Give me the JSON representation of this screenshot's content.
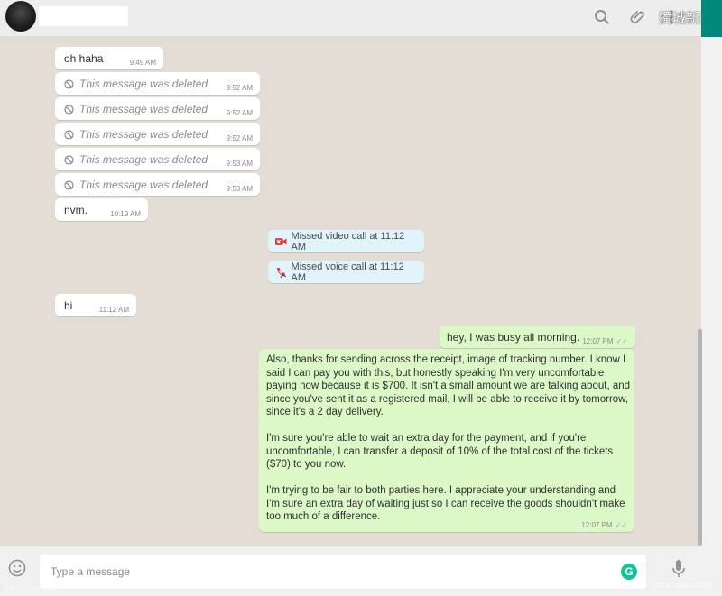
{
  "header": {
    "watermark": "獨城新闻",
    "icons": [
      "search-icon",
      "attach-icon",
      "menu-icon"
    ]
  },
  "messages": [
    {
      "type": "in",
      "text": "oh haha",
      "time": "9:49 AM"
    },
    {
      "type": "in-deleted",
      "text": "This message was deleted",
      "time": "9:52 AM"
    },
    {
      "type": "in-deleted",
      "text": "This message was deleted",
      "time": "9:52 AM"
    },
    {
      "type": "in-deleted",
      "text": "This message was deleted",
      "time": "9:52 AM"
    },
    {
      "type": "in-deleted",
      "text": "This message was deleted",
      "time": "9:53 AM"
    },
    {
      "type": "in-deleted",
      "text": "This message was deleted",
      "time": "9:53 AM"
    },
    {
      "type": "in",
      "text": "nvm.",
      "time": "10:19 AM"
    },
    {
      "type": "system",
      "text": "Missed video call at 11:12 AM",
      "icon": "missed-video-call-icon"
    },
    {
      "type": "system",
      "text": "Missed voice call at 11:12 AM",
      "icon": "missed-voice-call-icon"
    },
    {
      "type": "in",
      "text": "hi",
      "time": "11:12 AM"
    },
    {
      "type": "out",
      "text": "hey, I was busy all morning.",
      "time": "12:07 PM"
    },
    {
      "type": "out",
      "text": "Also, thanks for sending across the receipt, image of tracking number. I know I\nsaid I can pay you with this, but honestly speaking I'm very uncomfortable\npaying now because it is $700. It isn't a small amount we are talking about, and\nsince you've sent it as a registered mail, I will be able to receive it by tomorrow,\nsince it's a 2 day delivery.\n\nI'm sure you're able to wait an extra day for the payment, and if you're\nuncomfortable, I can transfer a deposit of 10% of the total cost of the tickets\n($70) to you now.\n\nI'm trying to be fair to both parties here. I appreciate your understanding and\nI'm sure an extra day of waiting just so I can receive the goods shouldn't make\ntoo much of a difference.",
      "time": "12:07 PM"
    }
  ],
  "footer": {
    "placeholder": "Type a message",
    "grammarly": "G",
    "watermark_left": "hk.sinanews",
    "watermark_right": "sina.news.com"
  },
  "colors": {
    "incoming": "#ffffff",
    "outgoing": "#dcf8c6",
    "system": "#e1f3fb",
    "accent": "#00897b"
  }
}
